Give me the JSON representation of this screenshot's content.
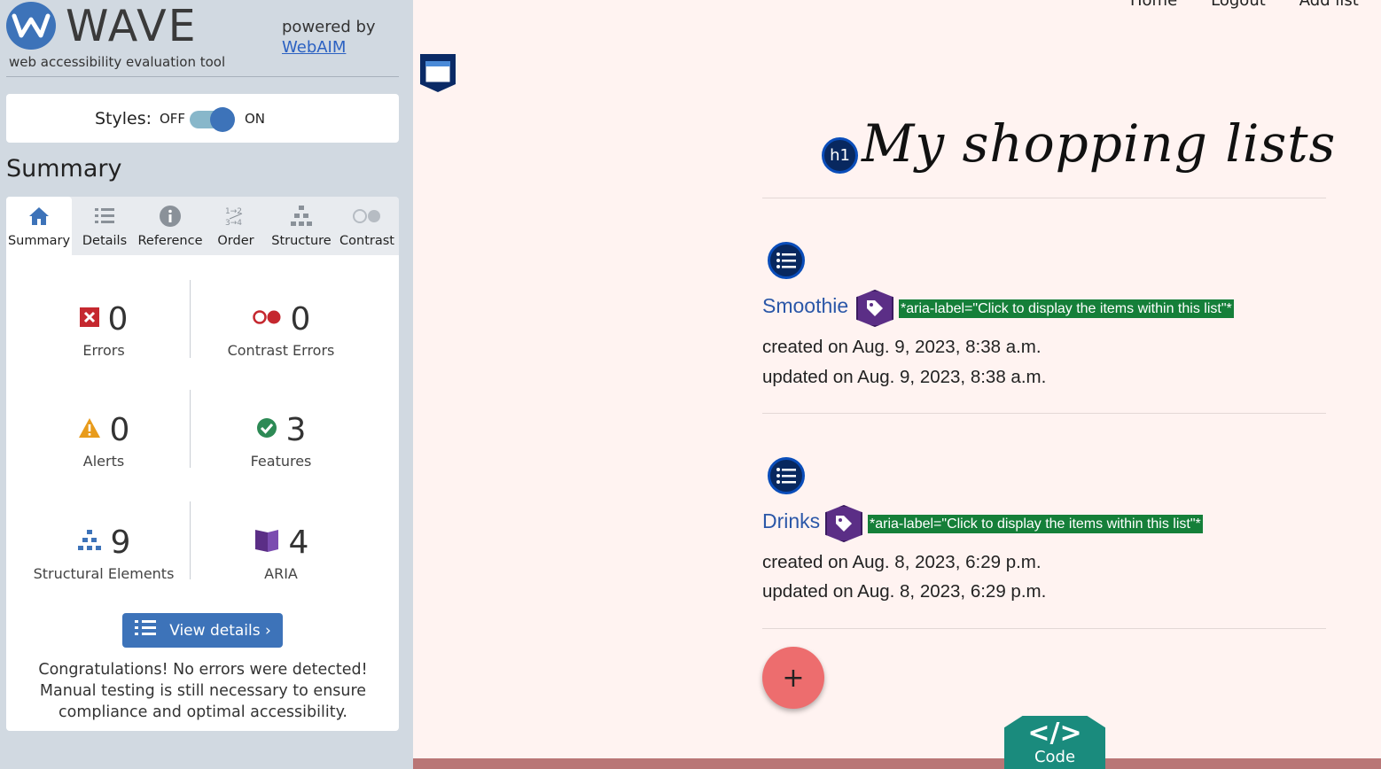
{
  "wave": {
    "name": "WAVE",
    "tagline": "web accessibility evaluation tool",
    "powered_by": "powered by",
    "webaim": "WebAIM",
    "styles_label": "Styles:",
    "off": "OFF",
    "on": "ON",
    "summary_title": "Summary",
    "tabs": [
      {
        "label": "Summary",
        "icon": "home-icon"
      },
      {
        "label": "Details",
        "icon": "list-icon"
      },
      {
        "label": "Reference",
        "icon": "info-icon"
      },
      {
        "label": "Order",
        "icon": "order-icon"
      },
      {
        "label": "Structure",
        "icon": "structure-icon"
      },
      {
        "label": "Contrast",
        "icon": "contrast-icon"
      }
    ],
    "stats": {
      "errors": {
        "value": "0",
        "label": "Errors"
      },
      "contrast_errors": {
        "value": "0",
        "label": "Contrast Errors"
      },
      "alerts": {
        "value": "0",
        "label": "Alerts"
      },
      "features": {
        "value": "3",
        "label": "Features"
      },
      "structural": {
        "value": "9",
        "label": "Structural Elements"
      },
      "aria": {
        "value": "4",
        "label": "ARIA"
      }
    },
    "view_details": "View details ›",
    "congrats": "Congratulations! No errors were detected! Manual testing is still necessary to ensure compliance and optimal accessibility."
  },
  "page": {
    "nav": [
      "Home",
      "Logout",
      "Add list"
    ],
    "title": "My shopping lists",
    "h1_badge": "h1",
    "lists": [
      {
        "name": "Smoothie",
        "aria_label": "*aria-label=\"Click to display the items within this list\"*",
        "created": "created on Aug. 9, 2023, 8:38 a.m.",
        "updated": "updated on Aug. 9, 2023, 8:38 a.m."
      },
      {
        "name": "Drinks",
        "aria_label": "*aria-label=\"Click to display the items within this list\"*",
        "created": "created on Aug. 8, 2023, 6:29 p.m.",
        "updated": "updated on Aug. 8, 2023, 6:29 p.m."
      }
    ],
    "add_symbol": "+",
    "code_symbol": "</>",
    "code_label": "Code"
  },
  "colors": {
    "wave_blue": "#3d73b9",
    "sidebar_bg": "#d1d9e1",
    "page_bg": "#fff3f1",
    "aria_green": "#157f39",
    "fab": "#ed6d6e",
    "code_teal": "#1a8b7d"
  }
}
